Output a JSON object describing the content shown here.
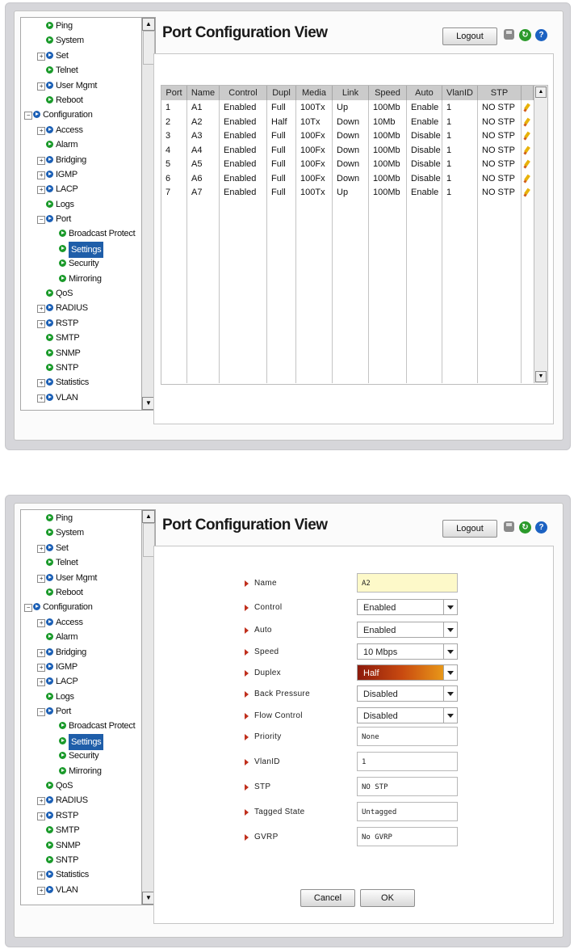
{
  "page": {
    "title": "Port Configuration View",
    "logout_label": "Logout"
  },
  "icons": {
    "save": "save-icon",
    "refresh": "refresh-icon",
    "help": "help-icon"
  },
  "tree": [
    {
      "label": "Ping",
      "level": 2,
      "bullet": "green"
    },
    {
      "label": "System",
      "level": 2,
      "bullet": "green"
    },
    {
      "label": "Set",
      "level": 2,
      "bullet": "blue",
      "expander": "+"
    },
    {
      "label": "Telnet",
      "level": 2,
      "bullet": "green"
    },
    {
      "label": "User Mgmt",
      "level": 2,
      "bullet": "blue",
      "expander": "+"
    },
    {
      "label": "Reboot",
      "level": 2,
      "bullet": "green"
    },
    {
      "label": "Configuration",
      "level": 1,
      "bullet": "blue",
      "expander": "−"
    },
    {
      "label": "Access",
      "level": 2,
      "bullet": "blue",
      "expander": "+"
    },
    {
      "label": "Alarm",
      "level": 2,
      "bullet": "green"
    },
    {
      "label": "Bridging",
      "level": 2,
      "bullet": "blue",
      "expander": "+"
    },
    {
      "label": "IGMP",
      "level": 2,
      "bullet": "blue",
      "expander": "+"
    },
    {
      "label": "LACP",
      "level": 2,
      "bullet": "blue",
      "expander": "+"
    },
    {
      "label": "Logs",
      "level": 2,
      "bullet": "green"
    },
    {
      "label": "Port",
      "level": 2,
      "bullet": "blue",
      "expander": "−"
    },
    {
      "label": "Broadcast Protect",
      "level": 3,
      "bullet": "green"
    },
    {
      "label": "Settings",
      "level": 3,
      "bullet": "green",
      "selected": true
    },
    {
      "label": "Security",
      "level": 3,
      "bullet": "green"
    },
    {
      "label": "Mirroring",
      "level": 3,
      "bullet": "green"
    },
    {
      "label": "QoS",
      "level": 2,
      "bullet": "green"
    },
    {
      "label": "RADIUS",
      "level": 2,
      "bullet": "blue",
      "expander": "+"
    },
    {
      "label": "RSTP",
      "level": 2,
      "bullet": "blue",
      "expander": "+"
    },
    {
      "label": "SMTP",
      "level": 2,
      "bullet": "green"
    },
    {
      "label": "SNMP",
      "level": 2,
      "bullet": "green"
    },
    {
      "label": "SNTP",
      "level": 2,
      "bullet": "green"
    },
    {
      "label": "Statistics",
      "level": 2,
      "bullet": "blue",
      "expander": "+"
    },
    {
      "label": "VLAN",
      "level": 2,
      "bullet": "blue",
      "expander": "+"
    }
  ],
  "port_table": {
    "columns": [
      "Port",
      "Name",
      "Control",
      "Dupl",
      "Media",
      "Link",
      "Speed",
      "Auto",
      "VlanID",
      "STP"
    ],
    "rows": [
      [
        "1",
        "A1",
        "Enabled",
        "Full",
        "100Tx",
        "Up",
        "100Mb",
        "Enable",
        "1",
        "NO STP"
      ],
      [
        "2",
        "A2",
        "Enabled",
        "Half",
        "10Tx",
        "Down",
        "10Mb",
        "Enable",
        "1",
        "NO STP"
      ],
      [
        "3",
        "A3",
        "Enabled",
        "Full",
        "100Fx",
        "Down",
        "100Mb",
        "Disable",
        "1",
        "NO STP"
      ],
      [
        "4",
        "A4",
        "Enabled",
        "Full",
        "100Fx",
        "Down",
        "100Mb",
        "Disable",
        "1",
        "NO STP"
      ],
      [
        "5",
        "A5",
        "Enabled",
        "Full",
        "100Fx",
        "Down",
        "100Mb",
        "Disable",
        "1",
        "NO STP"
      ],
      [
        "6",
        "A6",
        "Enabled",
        "Full",
        "100Fx",
        "Down",
        "100Mb",
        "Disable",
        "1",
        "NO STP"
      ],
      [
        "7",
        "A7",
        "Enabled",
        "Full",
        "100Tx",
        "Up",
        "100Mb",
        "Enable",
        "1",
        "NO STP"
      ]
    ],
    "edit_icon": "pencil-icon"
  },
  "edit_form": {
    "fields": [
      {
        "label": "Name",
        "type": "text",
        "value": "A2",
        "highlight": true
      },
      {
        "label": "Control",
        "type": "select",
        "value": "Enabled"
      },
      {
        "label": "Auto",
        "type": "select",
        "value": "Enabled"
      },
      {
        "label": "Speed",
        "type": "select",
        "value": "10 Mbps"
      },
      {
        "label": "Duplex",
        "type": "select",
        "value": "Half",
        "active": true
      },
      {
        "label": "Back Pressure",
        "type": "select",
        "value": "Disabled"
      },
      {
        "label": "Flow Control",
        "type": "select",
        "value": "Disabled"
      },
      {
        "label": "Priority",
        "type": "text",
        "value": "None"
      },
      {
        "label": "VlanID",
        "type": "text",
        "value": "1"
      },
      {
        "label": "STP",
        "type": "text",
        "value": "NO STP"
      },
      {
        "label": "Tagged State",
        "type": "text",
        "value": "Untagged"
      },
      {
        "label": "GVRP",
        "type": "text",
        "value": "No GVRP"
      }
    ],
    "cancel_label": "Cancel",
    "ok_label": "OK"
  },
  "colors": {
    "selected_item": "#1f5ea9",
    "label_arrow": "#c0301d",
    "active_select": "#c94a10"
  }
}
